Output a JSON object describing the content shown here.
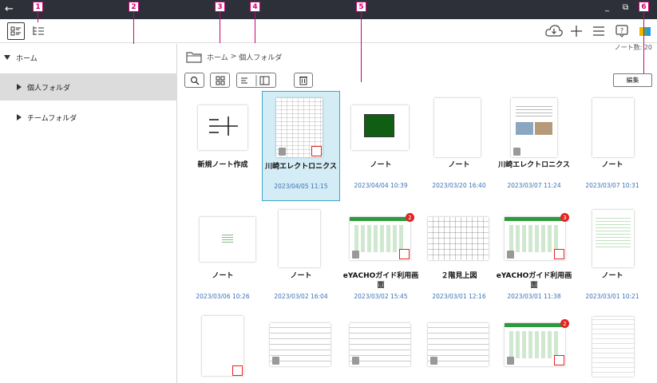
{
  "titlebar": {
    "back": "←",
    "minimize": "_",
    "maximize": "⧉",
    "close": "⤢"
  },
  "toolbar": {
    "note_count": "ノート数: 20"
  },
  "sidebar": {
    "items": [
      {
        "label": "ホーム"
      },
      {
        "label": "個人フォルダ"
      },
      {
        "label": "チームフォルダ"
      }
    ]
  },
  "main": {
    "breadcrumb": {
      "home": "ホーム",
      "sep": ">",
      "current": "個人フォルダ"
    },
    "edit_label": "編集"
  },
  "cards": [
    {
      "title": "新規ノート作成",
      "date": ""
    },
    {
      "title": "川崎エレクトロニクス",
      "date": "2023/04/05 11:15"
    },
    {
      "title": "ノート",
      "date": "2023/04/04 10:39"
    },
    {
      "title": "ノート",
      "date": "2023/03/20 16:40"
    },
    {
      "title": "川崎エレクトロニクス",
      "date": "2023/03/07 11:24"
    },
    {
      "title": "ノート",
      "date": "2023/03/07 10:31"
    },
    {
      "title": "ノート",
      "date": "2023/03/06 10:26"
    },
    {
      "title": "ノート",
      "date": "2023/03/02 16:04"
    },
    {
      "title": "eYACHOガイド利用画面",
      "date": "2023/03/02 15:45"
    },
    {
      "title": "２階見上図",
      "date": "2023/03/01 12:16"
    },
    {
      "title": "eYACHOガイド利用画面",
      "date": "2023/03/01 11:38"
    },
    {
      "title": "ノート",
      "date": "2023/03/01 10:21"
    }
  ],
  "badges": {
    "card9": "2",
    "card11": "3",
    "card17": "2"
  },
  "callouts": [
    "1",
    "2",
    "3",
    "4",
    "5",
    "6"
  ],
  "colors": {
    "titlebar": "#2d3038",
    "accent": "#3aa6cc",
    "date": "#3b72b5",
    "callout": "#d1007a",
    "badge": "#e02424"
  }
}
